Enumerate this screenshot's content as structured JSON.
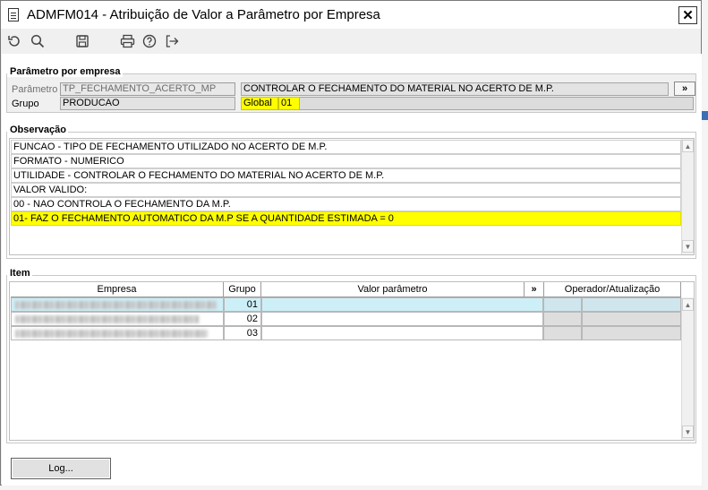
{
  "window": {
    "title": "ADMFM014 - Atribuição de Valor a Parâmetro por Empresa",
    "close_label": "✕"
  },
  "toolbar": {
    "icons": [
      "refresh-icon",
      "search-icon",
      "save-icon",
      "print-icon",
      "help-icon",
      "exit-icon"
    ]
  },
  "param_group": {
    "legend": "Parâmetro por empresa",
    "parametro_label": "Parâmetro",
    "parametro_value": "TP_FECHAMENTO_ACERTO_MP",
    "descricao_value": "CONTROLAR O FECHAMENTO DO MATERIAL NO ACERTO DE M.P.",
    "expand_label": "»",
    "grupo_label": "Grupo",
    "grupo_value": "PRODUCAO",
    "global_label": "Global",
    "global_value": "01"
  },
  "observacao": {
    "legend": "Observação",
    "lines": [
      "FUNCAO - TIPO DE FECHAMENTO UTILIZADO NO ACERTO DE M.P.",
      "FORMATO - NUMERICO",
      "UTILIDADE - CONTROLAR O FECHAMENTO DO MATERIAL NO ACERTO DE M.P.",
      "VALOR VALIDO:",
      "00 - NAO CONTROLA O FECHAMENTO DA M.P.",
      "01- FAZ O FECHAMENTO AUTOMATICO DA M.P SE A QUANTIDADE ESTIMADA = 0"
    ]
  },
  "item": {
    "legend": "Item",
    "columns": {
      "empresa": "Empresa",
      "grupo": "Grupo",
      "valor": "Valor parâmetro",
      "expand": "»",
      "operador": "Operador/Atualização"
    },
    "rows": [
      {
        "grupo": "01"
      },
      {
        "grupo": "02"
      },
      {
        "grupo": "03"
      }
    ]
  },
  "footer": {
    "log_button": "Log..."
  },
  "colors": {
    "highlight": "#ffff00",
    "selected_row": "#cdeff8",
    "window_bg": "#f0f0f0"
  }
}
